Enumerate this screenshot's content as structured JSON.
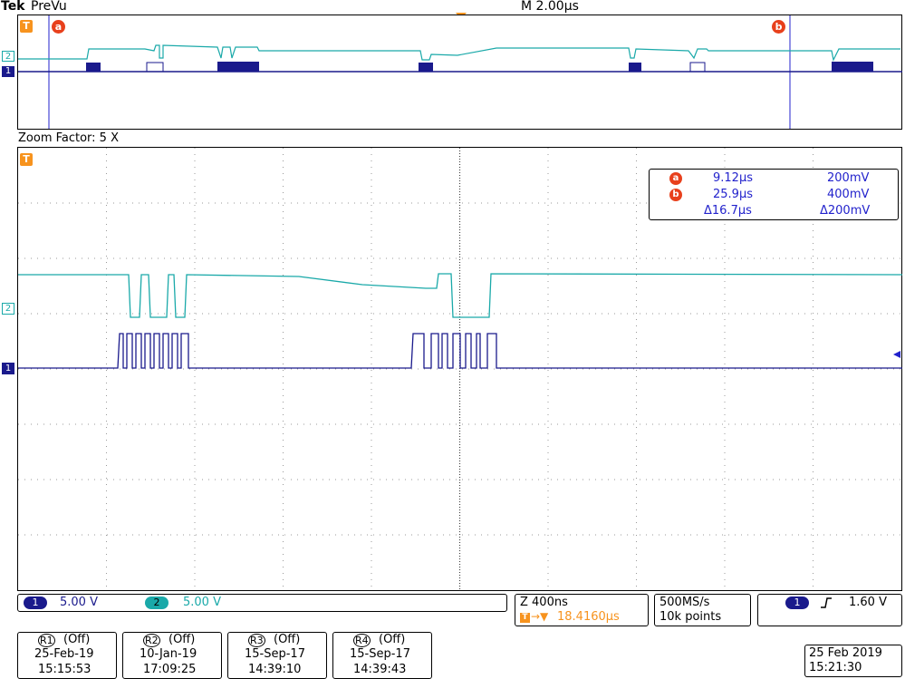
{
  "header": {
    "brand": "Tek",
    "mode": "PreVu",
    "timebase": "M 2.00µs"
  },
  "zoom": {
    "label": "Zoom Factor: 5 X"
  },
  "cursors": {
    "a": {
      "marker": "a",
      "time": "9.12µs",
      "volt": "200mV"
    },
    "b": {
      "marker": "b",
      "time": "25.9µs",
      "volt": "400mV"
    },
    "delta": {
      "time": "Δ16.7µs",
      "volt": "Δ200mV"
    }
  },
  "channels": {
    "ch1": {
      "label": "1",
      "scale": "5.00 V",
      "color": "#1a1a8c"
    },
    "ch2": {
      "label": "2",
      "scale": "5.00 V",
      "color": "#1aa9a9"
    }
  },
  "horizontal": {
    "zoom_scale": "Z 400ns",
    "trigger_pos": "18.4160µs"
  },
  "acquisition": {
    "rate": "500MS/s",
    "points": "10k points"
  },
  "trigger": {
    "channel": "1",
    "slope": "rising",
    "level": "1.60 V"
  },
  "refs": [
    {
      "label": "R1",
      "state": "(Off)",
      "date": "25-Feb-19",
      "time": "15:15:53"
    },
    {
      "label": "R2",
      "state": "(Off)",
      "date": "10-Jan-19",
      "time": "17:09:25"
    },
    {
      "label": "R3",
      "state": "(Off)",
      "date": "15-Sep-17",
      "time": "14:39:10"
    },
    {
      "label": "R4",
      "state": "(Off)",
      "date": "15-Sep-17",
      "time": "14:39:43"
    }
  ],
  "clock": {
    "date": "25 Feb  2019",
    "time": "15:21:30"
  },
  "markers": {
    "trigger": "T",
    "ch2": "2",
    "ch1": "1"
  },
  "colors": {
    "accent_orange": "#f7931e",
    "cursor_red": "#e8401c",
    "cursor_line": "#2222cc"
  }
}
